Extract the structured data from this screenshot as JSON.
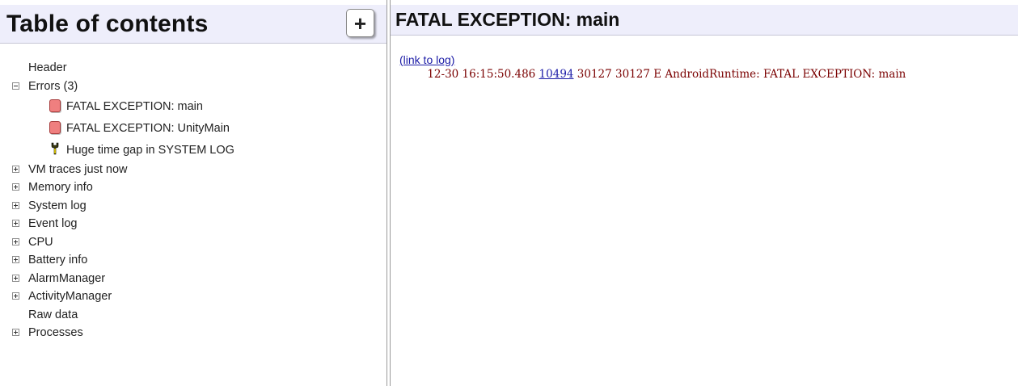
{
  "toc": {
    "title": "Table of contents",
    "add_button": "+",
    "items": [
      {
        "label": "Header",
        "expander": "none"
      },
      {
        "label": "Errors (3)",
        "expander": "minus",
        "children": [
          {
            "label": "FATAL EXCEPTION: main",
            "icon": "error-icon"
          },
          {
            "label": "FATAL EXCEPTION: UnityMain",
            "icon": "error-icon"
          },
          {
            "label": "Huge time gap in SYSTEM LOG",
            "icon": "wrench-icon"
          }
        ]
      },
      {
        "label": "VM traces just now",
        "expander": "plus"
      },
      {
        "label": "Memory info",
        "expander": "plus"
      },
      {
        "label": "System log",
        "expander": "plus"
      },
      {
        "label": "Event log",
        "expander": "plus"
      },
      {
        "label": "CPU",
        "expander": "plus"
      },
      {
        "label": "Battery info",
        "expander": "plus"
      },
      {
        "label": "AlarmManager",
        "expander": "plus"
      },
      {
        "label": "ActivityManager",
        "expander": "plus"
      },
      {
        "label": "Raw data",
        "expander": "none"
      },
      {
        "label": "Processes",
        "expander": "plus"
      }
    ]
  },
  "detail": {
    "title": "FATAL EXCEPTION: main",
    "link_text": "(link to log)",
    "log": {
      "indent": "        ",
      "prefix": "12-30 16:15:50.486 ",
      "pid_link": "10494",
      "rest": " 30127 30127 E AndroidRuntime: FATAL EXCEPTION: main"
    }
  },
  "colors": {
    "header_bg": "#eeeefb",
    "error_red": "#ef7f7f",
    "link_blue": "#1a1aa6",
    "log_text": "#7a0000"
  }
}
